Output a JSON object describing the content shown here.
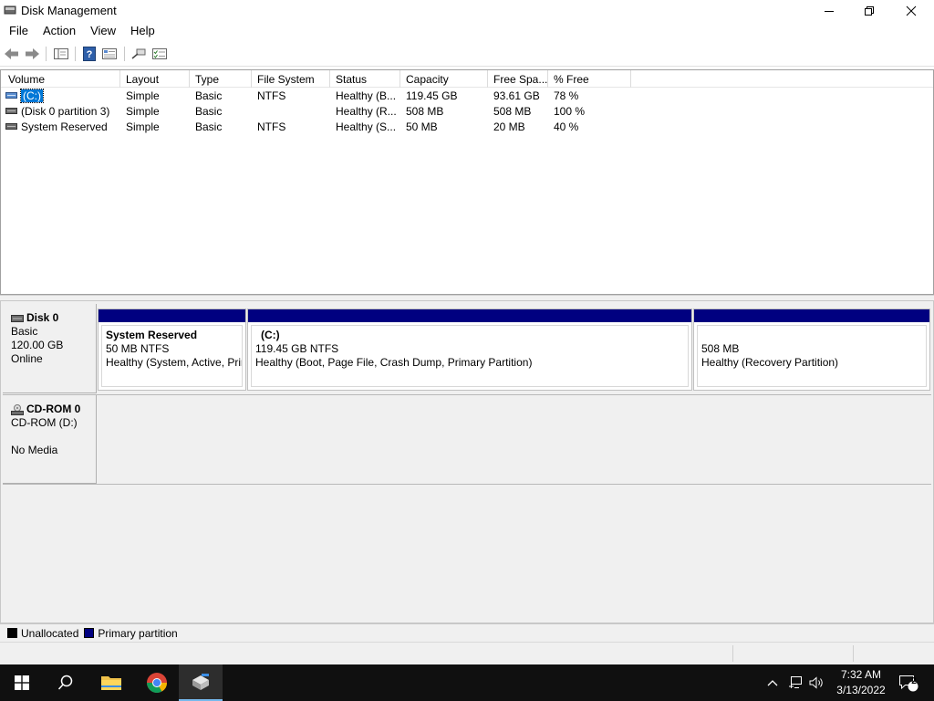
{
  "window": {
    "title": "Disk Management"
  },
  "menu": [
    "File",
    "Action",
    "View",
    "Help"
  ],
  "volume_list": {
    "columns": [
      "Volume",
      "Layout",
      "Type",
      "File System",
      "Status",
      "Capacity",
      "Free Spa...",
      "% Free"
    ],
    "rows": [
      {
        "volume": "(C:)",
        "layout": "Simple",
        "type": "Basic",
        "fs": "NTFS",
        "status": "Healthy (B...",
        "capacity": "119.45 GB",
        "free": "93.61 GB",
        "pct": "78 %"
      },
      {
        "volume": "(Disk 0 partition 3)",
        "layout": "Simple",
        "type": "Basic",
        "fs": "",
        "status": "Healthy (R...",
        "capacity": "508 MB",
        "free": "508 MB",
        "pct": "100 %"
      },
      {
        "volume": "System Reserved",
        "layout": "Simple",
        "type": "Basic",
        "fs": "NTFS",
        "status": "Healthy (S...",
        "capacity": "50 MB",
        "free": "20 MB",
        "pct": "40 %"
      }
    ]
  },
  "disks": [
    {
      "name": "Disk 0",
      "lines": [
        "Basic",
        "120.00 GB",
        "Online"
      ],
      "partitions": [
        {
          "name": "System Reserved",
          "size": "50 MB NTFS",
          "status": "Healthy (System, Active, Prir"
        },
        {
          "name": "(C:)",
          "size": "119.45 GB NTFS",
          "status": "Healthy (Boot, Page File, Crash Dump, Primary Partition)"
        },
        {
          "name": "",
          "size": "508 MB",
          "status": "Healthy (Recovery Partition)"
        }
      ]
    },
    {
      "name": "CD-ROM 0",
      "lines": [
        "CD-ROM (D:)",
        "",
        "No Media"
      ]
    }
  ],
  "legend": [
    {
      "label": "Unallocated",
      "color": "#000000"
    },
    {
      "label": "Primary partition",
      "color": "#000080"
    }
  ],
  "taskbar": {
    "time": "7:32 AM",
    "date": "3/13/2022",
    "notification_count": "2",
    "accent_color": "#76b9ed"
  },
  "icons": [
    "disk-management-app-icon",
    "back-icon",
    "forward-icon",
    "console-tree-icon",
    "help-icon",
    "properties-icon",
    "connect-icon",
    "settings-list-icon",
    "windows-start-icon",
    "search-icon",
    "file-explorer-icon",
    "chrome-icon",
    "disk-management-taskbar-icon",
    "chevron-up-icon",
    "network-icon",
    "volume-icon",
    "notification-icon"
  ]
}
